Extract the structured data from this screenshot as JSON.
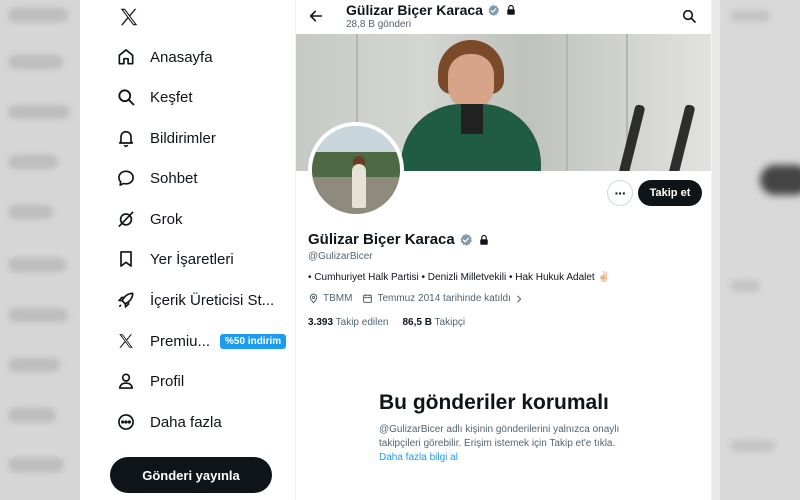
{
  "sidebar": {
    "items": [
      {
        "label": "Anasayfa",
        "icon": "home-icon"
      },
      {
        "label": "Keşfet",
        "icon": "search-icon"
      },
      {
        "label": "Bildirimler",
        "icon": "bell-icon"
      },
      {
        "label": "Sohbet",
        "icon": "chat-icon"
      },
      {
        "label": "Grok",
        "icon": "grok-icon"
      },
      {
        "label": "Yer İşaretleri",
        "icon": "bookmark-icon"
      },
      {
        "label": "İçerik Üreticisi St...",
        "icon": "rocket-icon"
      },
      {
        "label": "Premiu...",
        "icon": "x-logo-icon",
        "badge": "%50 indirim"
      },
      {
        "label": "Profil",
        "icon": "person-icon"
      },
      {
        "label": "Daha fazla",
        "icon": "more-circle-icon"
      }
    ],
    "post_button": "Gönderi yayınla"
  },
  "header": {
    "name": "Gülizar Biçer Karaca",
    "post_count": "28,8 B gönderi"
  },
  "profile": {
    "name": "Gülizar Biçer Karaca",
    "handle": "@GulizarBicer",
    "bio": "• Cumhuriyet Halk Partisi • Denizli Milletvekili • Hak Hukuk Adalet ✌🏻",
    "location": "TBMM",
    "joined": "Temmuz 2014 tarihinde katıldı",
    "following_count": "3.393",
    "following_label": "Takip edilen",
    "followers_count": "86,5 B",
    "followers_label": "Takipçi",
    "follow_button": "Takip et",
    "more_button": "···"
  },
  "protected": {
    "title": "Bu gönderiler korumalı",
    "text": "@GulizarBicer adlı kişinin gönderilerini yalnızca onaylı takipçileri görebilir. Erişim istemek için Takip et'e tıkla.",
    "link": "Daha fazla bilgi al"
  },
  "colors": {
    "accent": "#1d9bf0",
    "text": "#0f1419",
    "secondary": "#536471",
    "button_dark": "#0f1419"
  }
}
